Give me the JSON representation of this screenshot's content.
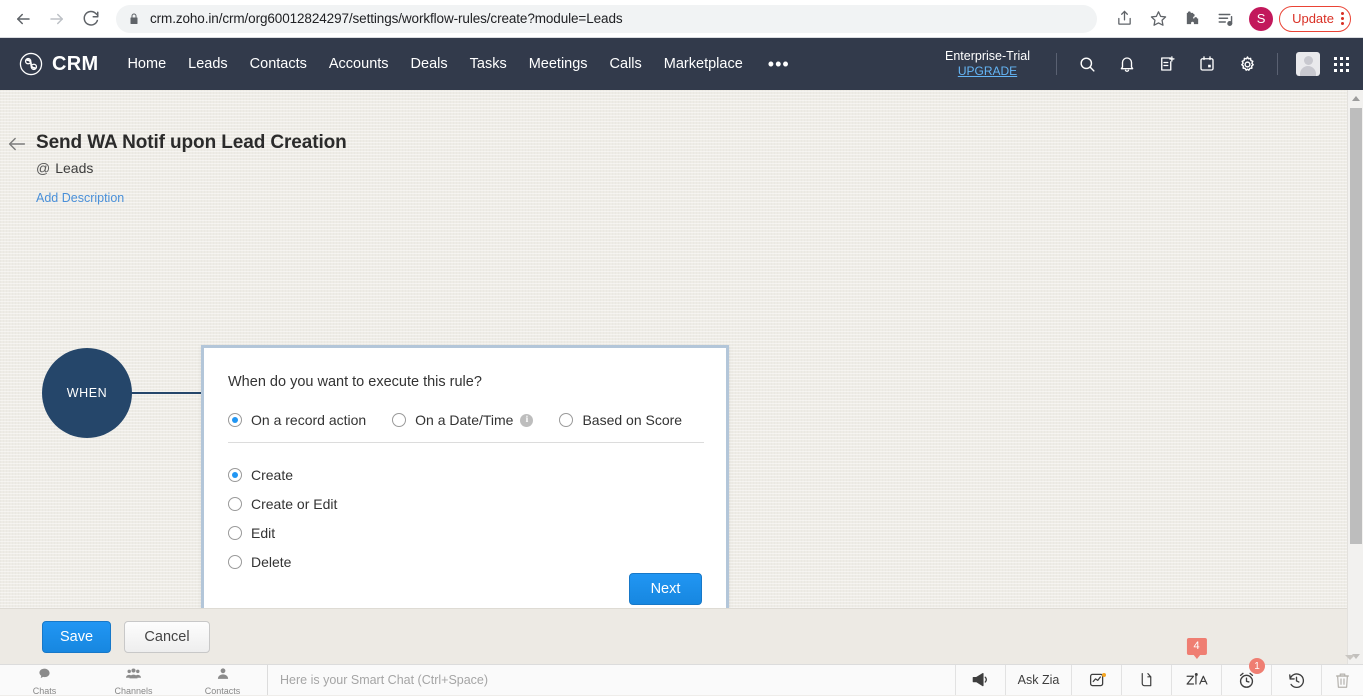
{
  "browser": {
    "url_prefix": "crm.zoho.in",
    "url_rest": "/crm/org60012824297/settings/workflow-rules/create?module=Leads",
    "back_icon": "back-arrow-icon",
    "forward_icon": "forward-arrow-icon",
    "reload_icon": "reload-icon",
    "lock_icon": "lock-icon",
    "share_icon": "share-icon",
    "bookmark_icon": "star-icon",
    "extensions_icon": "puzzle-icon",
    "readinglist_icon": "reading-list-icon",
    "profile_initial": "S",
    "update_label": "Update",
    "menu_icon": "kebab-menu-icon"
  },
  "crm_nav": {
    "logo_text": "CRM",
    "links": [
      "Home",
      "Leads",
      "Contacts",
      "Accounts",
      "Deals",
      "Tasks",
      "Meetings",
      "Calls",
      "Marketplace"
    ],
    "more_label": "•••",
    "trial_name": "Enterprise-Trial",
    "trial_upgrade": "UPGRADE",
    "icons": [
      "search-icon",
      "bell-icon",
      "note-add-icon",
      "calendar-icon",
      "gear-icon"
    ]
  },
  "page": {
    "back_icon": "back-arrow-icon",
    "title": "Send WA Notif upon Lead Creation",
    "module_prefix": "@",
    "module": "Leads",
    "add_description": "Add Description"
  },
  "flow": {
    "when_node": "WHEN"
  },
  "card": {
    "question": "When do you want to execute this rule?",
    "modes": [
      {
        "label": "On a record action",
        "checked": true,
        "info": false
      },
      {
        "label": "On a Date/Time",
        "checked": false,
        "info": true
      },
      {
        "label": "Based on Score",
        "checked": false,
        "info": false
      }
    ],
    "info_glyph": "i",
    "actions": [
      {
        "label": "Create",
        "checked": true
      },
      {
        "label": "Create or Edit",
        "checked": false
      },
      {
        "label": "Edit",
        "checked": false
      },
      {
        "label": "Delete",
        "checked": false
      }
    ],
    "next_label": "Next"
  },
  "footer": {
    "save_label": "Save",
    "cancel_label": "Cancel"
  },
  "taskbar": {
    "tabs": [
      {
        "label": "Chats",
        "icon": "chat-bubble-icon"
      },
      {
        "label": "Channels",
        "icon": "group-icon"
      },
      {
        "label": "Contacts",
        "icon": "person-icon"
      }
    ],
    "chat_placeholder": "Here is your Smart Chat (Ctrl+Space)",
    "right_buttons": [
      {
        "name": "megaphone-icon",
        "label": "",
        "badge": ""
      },
      {
        "name": "ask-zia-button",
        "label": "Ask Zia",
        "badge": ""
      },
      {
        "name": "analytics-icon",
        "label": "",
        "badge": ""
      },
      {
        "name": "feed-icon",
        "label": "",
        "badge": ""
      },
      {
        "name": "zia-icon",
        "label": "",
        "badge": "4"
      },
      {
        "name": "alarm-clock-icon",
        "label": "",
        "badge": "1"
      },
      {
        "name": "history-icon",
        "label": "",
        "badge": ""
      },
      {
        "name": "trash-icon",
        "label": "",
        "badge": ""
      }
    ]
  },
  "colors": {
    "nav_bg": "#323a4b",
    "when_node": "#25466a",
    "accent_blue": "#2196f3",
    "card_border": "#b3c6d9",
    "badge_red": "#ef7e72",
    "link_blue": "#4a90d9"
  }
}
